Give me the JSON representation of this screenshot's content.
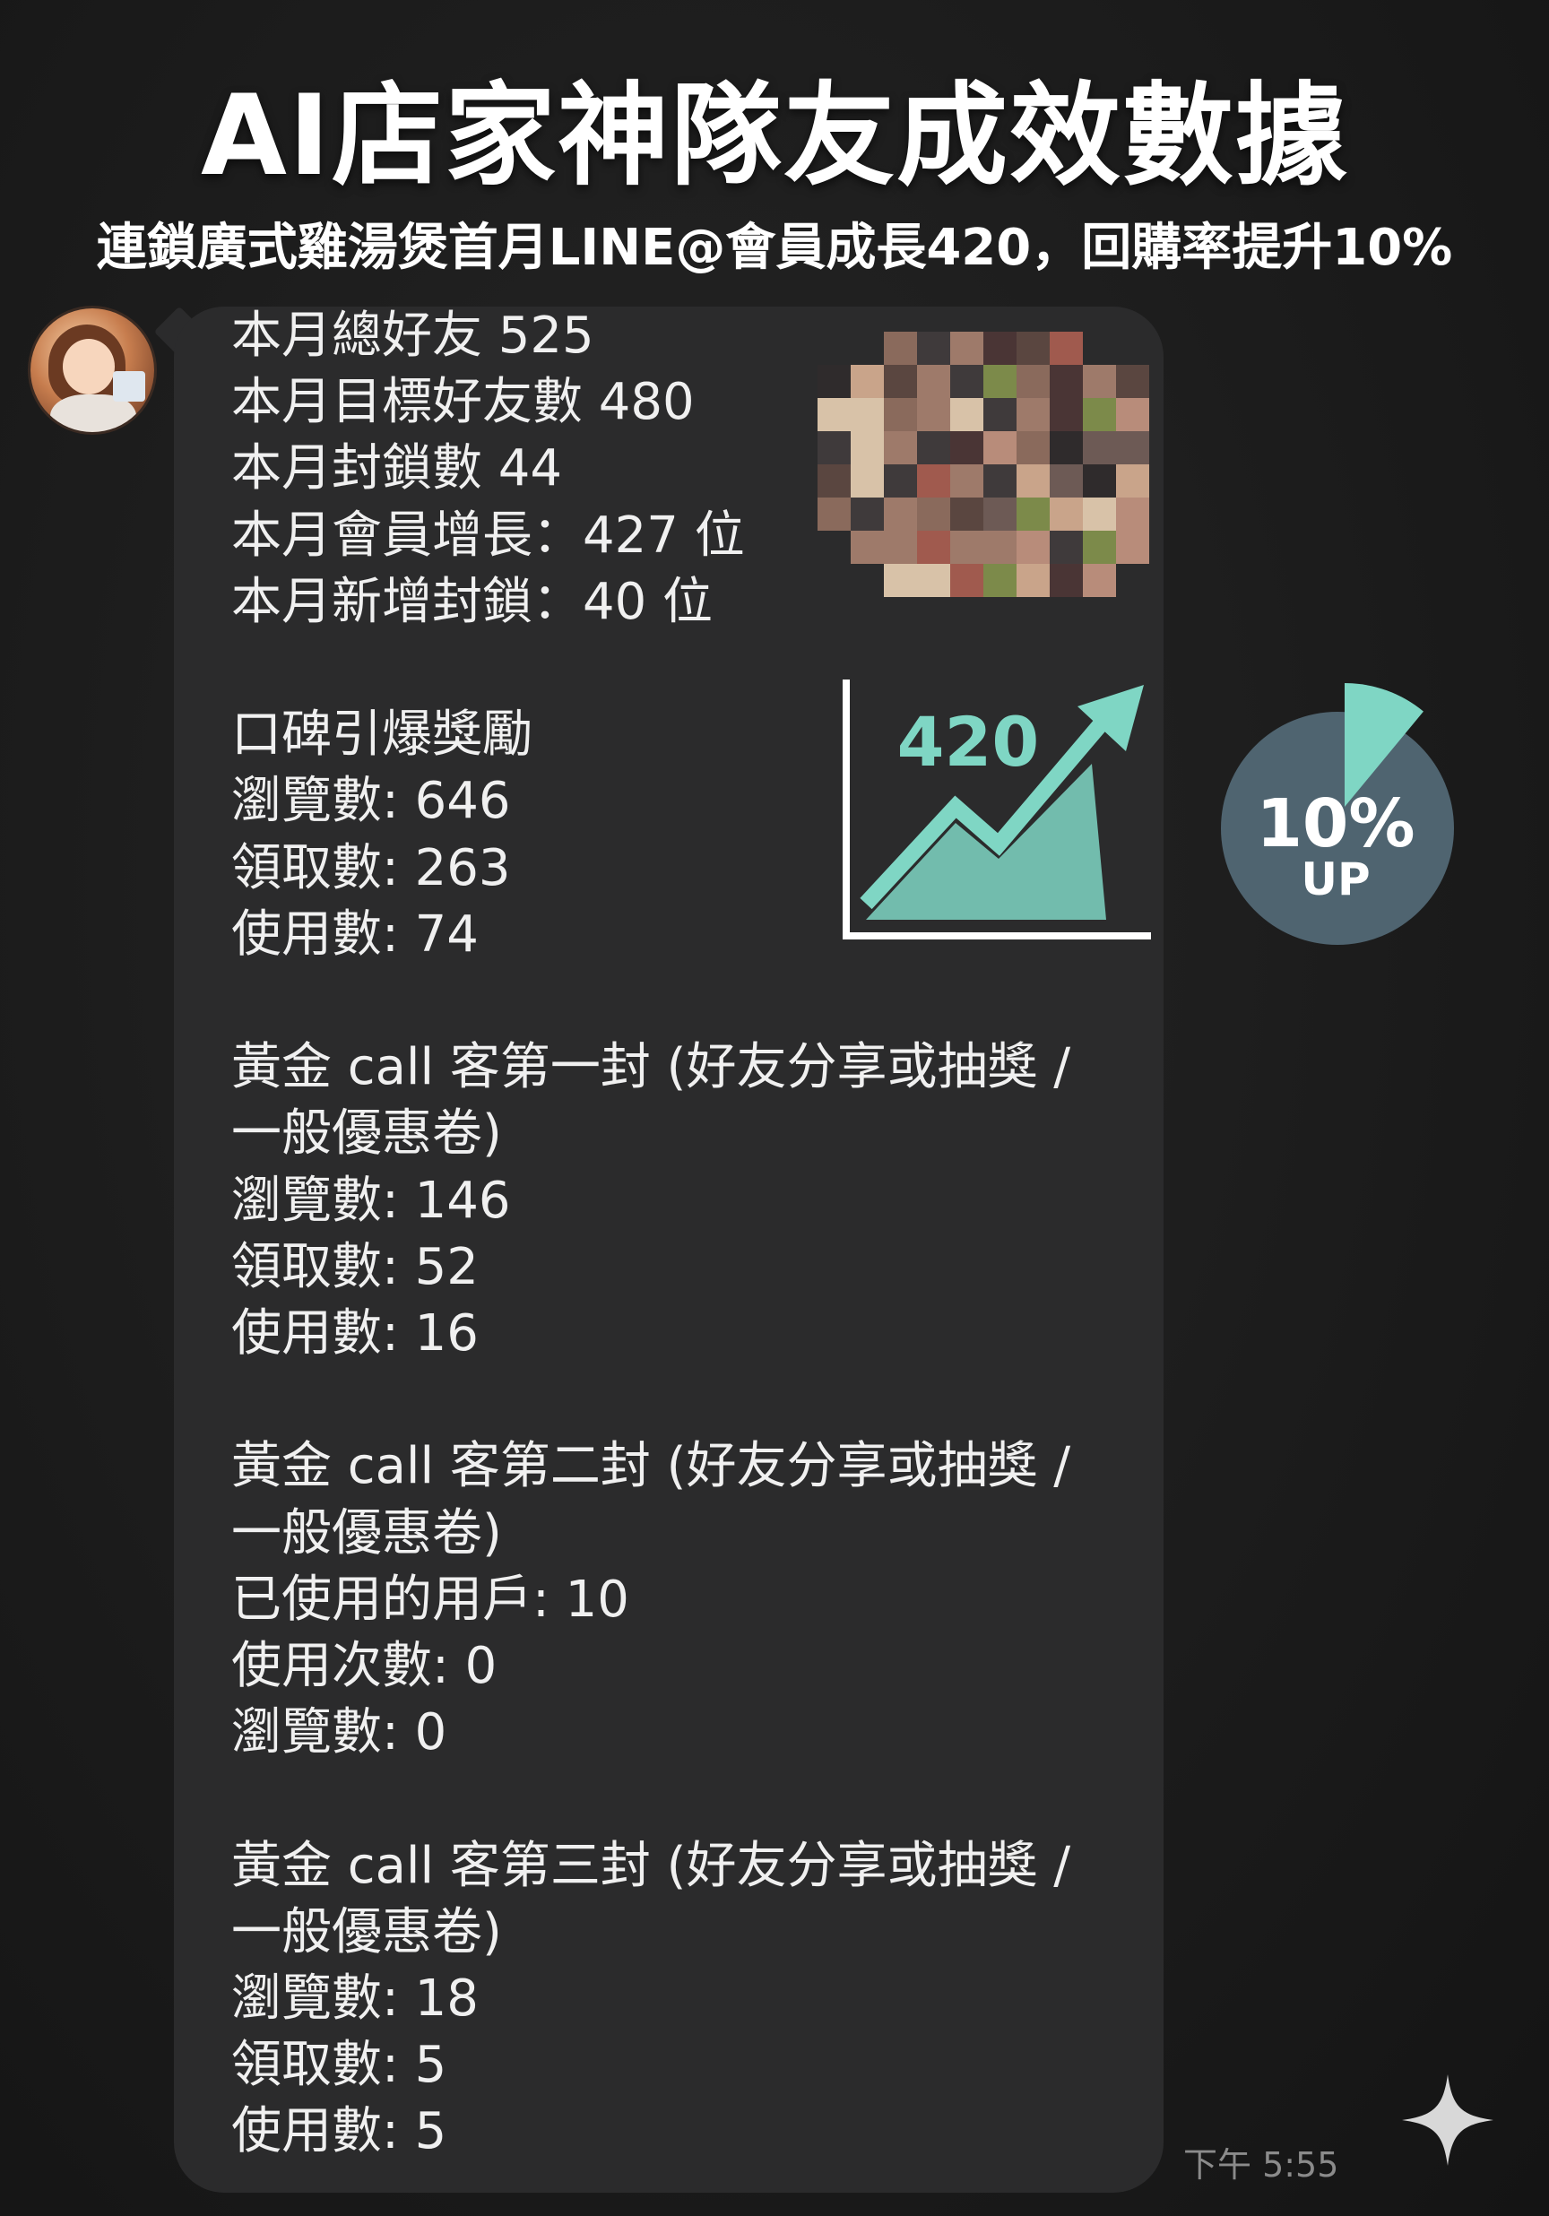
{
  "title": "AI店家神隊友成效數據",
  "subtitle": "連鎖廣式雞湯煲首月LINE@會員成長420，回購率提升10%",
  "chat": {
    "message_text": "本月總好友 525\n本月目標好友數 480\n本月封鎖數 44\n本月會員增長：427 位\n本月新增封鎖：40 位\n\n口碑引爆獎勵\n瀏覽數: 646\n領取數: 263\n使用數: 74\n\n黃金 call 客第一封 (好友分享或抽獎 /\n一般優惠卷)\n瀏覽數: 146\n領取數: 52\n使用數: 16\n\n黃金 call 客第二封 (好友分享或抽獎 /\n一般優惠卷)\n已使用的用戶: 10\n使用次數: 0\n瀏覽數: 0\n\n黃金 call 客第三封 (好友分享或抽獎 /\n一般優惠卷)\n瀏覽數: 18\n領取數: 5\n使用數: 5",
    "timestamp": "下午 5:55"
  },
  "growth_badge": {
    "value": "420",
    "color": "#7fd6c4"
  },
  "repurchase_badge": {
    "percent_text": "10%",
    "up_text": "UP",
    "fraction": 0.1,
    "circle_color": "#4f6470",
    "slice_color": "#7fd6c4"
  },
  "icons": {
    "avatar": "avatar-icon",
    "sparkle": "sparkle-icon"
  }
}
